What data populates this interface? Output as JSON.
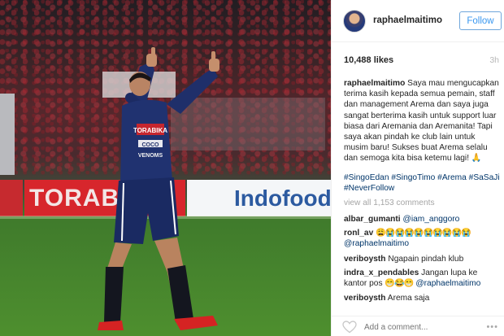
{
  "photo": {
    "board_left_text": "TORABIKA",
    "board_right_text": "Indofood",
    "jersey_text": "TORABIKA COCO VENOMS"
  },
  "header": {
    "username": "raphaelmaitimo",
    "follow_label": "Follow"
  },
  "post": {
    "likes": "10,488 likes",
    "time": "3h",
    "caption_user": "raphaelmaitimo",
    "caption_text": " Saya mau mengucapkan terima kasih kepada semua pemain, staff dan management Arema dan saya juga sangat berterima kasih untuk support luar biasa dari Aremania dan Aremanita! Tapi saya akan pindah ke club lain untuk musim baru! Sukses buat Arema selalu dan semoga kita bisa ketemu lagi! ",
    "caption_emoji": "🙏",
    "hashtags": "#SingoEdan #SingoTimo #Arema #SaSaJi #NeverFollow",
    "view_all": "view all 1,153 comments"
  },
  "comments": [
    {
      "user": "albar_gumanti",
      "text": "",
      "mention": "@iam_anggoro",
      "emoji": ""
    },
    {
      "user": "ronl_av",
      "text": "",
      "mention": "@raphaelmaitimo",
      "emoji": "😩😭😭😭😭😭😭😭😭😭"
    },
    {
      "user": "veriboysth",
      "text": " Ngapain pindah klub",
      "mention": "",
      "emoji": ""
    },
    {
      "user": "indra_x_pendables",
      "text": " Jangan lupa ke kantor pos ",
      "mention": "@raphaelmaitimo",
      "emoji": "😁😂😁"
    },
    {
      "user": "veriboysth",
      "text": " Arema saja",
      "mention": "",
      "emoji": ""
    }
  ],
  "footer": {
    "add_comment_placeholder": "Add a comment...",
    "more_label": "•••"
  },
  "colors": {
    "link": "#003569",
    "follow_blue": "#3897f0"
  }
}
